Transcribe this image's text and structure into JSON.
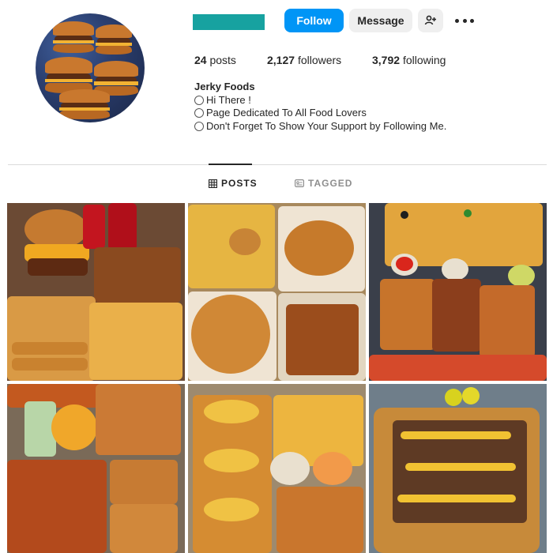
{
  "header": {
    "follow_label": "Follow",
    "message_label": "Message"
  },
  "stats": {
    "posts_count": "24",
    "posts_label": "posts",
    "followers_count": "2,127",
    "followers_label": "followers",
    "following_count": "3,792",
    "following_label": "following"
  },
  "bio": {
    "name": "Jerky Foods",
    "lines": [
      "Hi There !",
      "Page Dedicated To All Food Lovers",
      "Don't Forget To Show Your Support by Following Me."
    ]
  },
  "tabs": [
    {
      "label": "POSTS",
      "icon": "grid-icon",
      "active": true
    },
    {
      "label": "TAGGED",
      "icon": "tag-icon",
      "active": false
    }
  ],
  "colors": {
    "accent": "#0095f6",
    "username_redaction": "#17a2a0"
  },
  "posts": [
    {
      "subject": "burgers, coca-cola, chicken tenders, fries"
    },
    {
      "subject": "fries, chicken nuggets, burgers, fried chicken"
    },
    {
      "subject": "pizza slices, loaded fries, dipping sauces"
    },
    {
      "subject": "burgers, mac and cheese, loaded fries"
    },
    {
      "subject": "chicken sandwiches, fries, chicken strips, sauce"
    },
    {
      "subject": "loaded fries with cheese sauce and beef"
    }
  ]
}
